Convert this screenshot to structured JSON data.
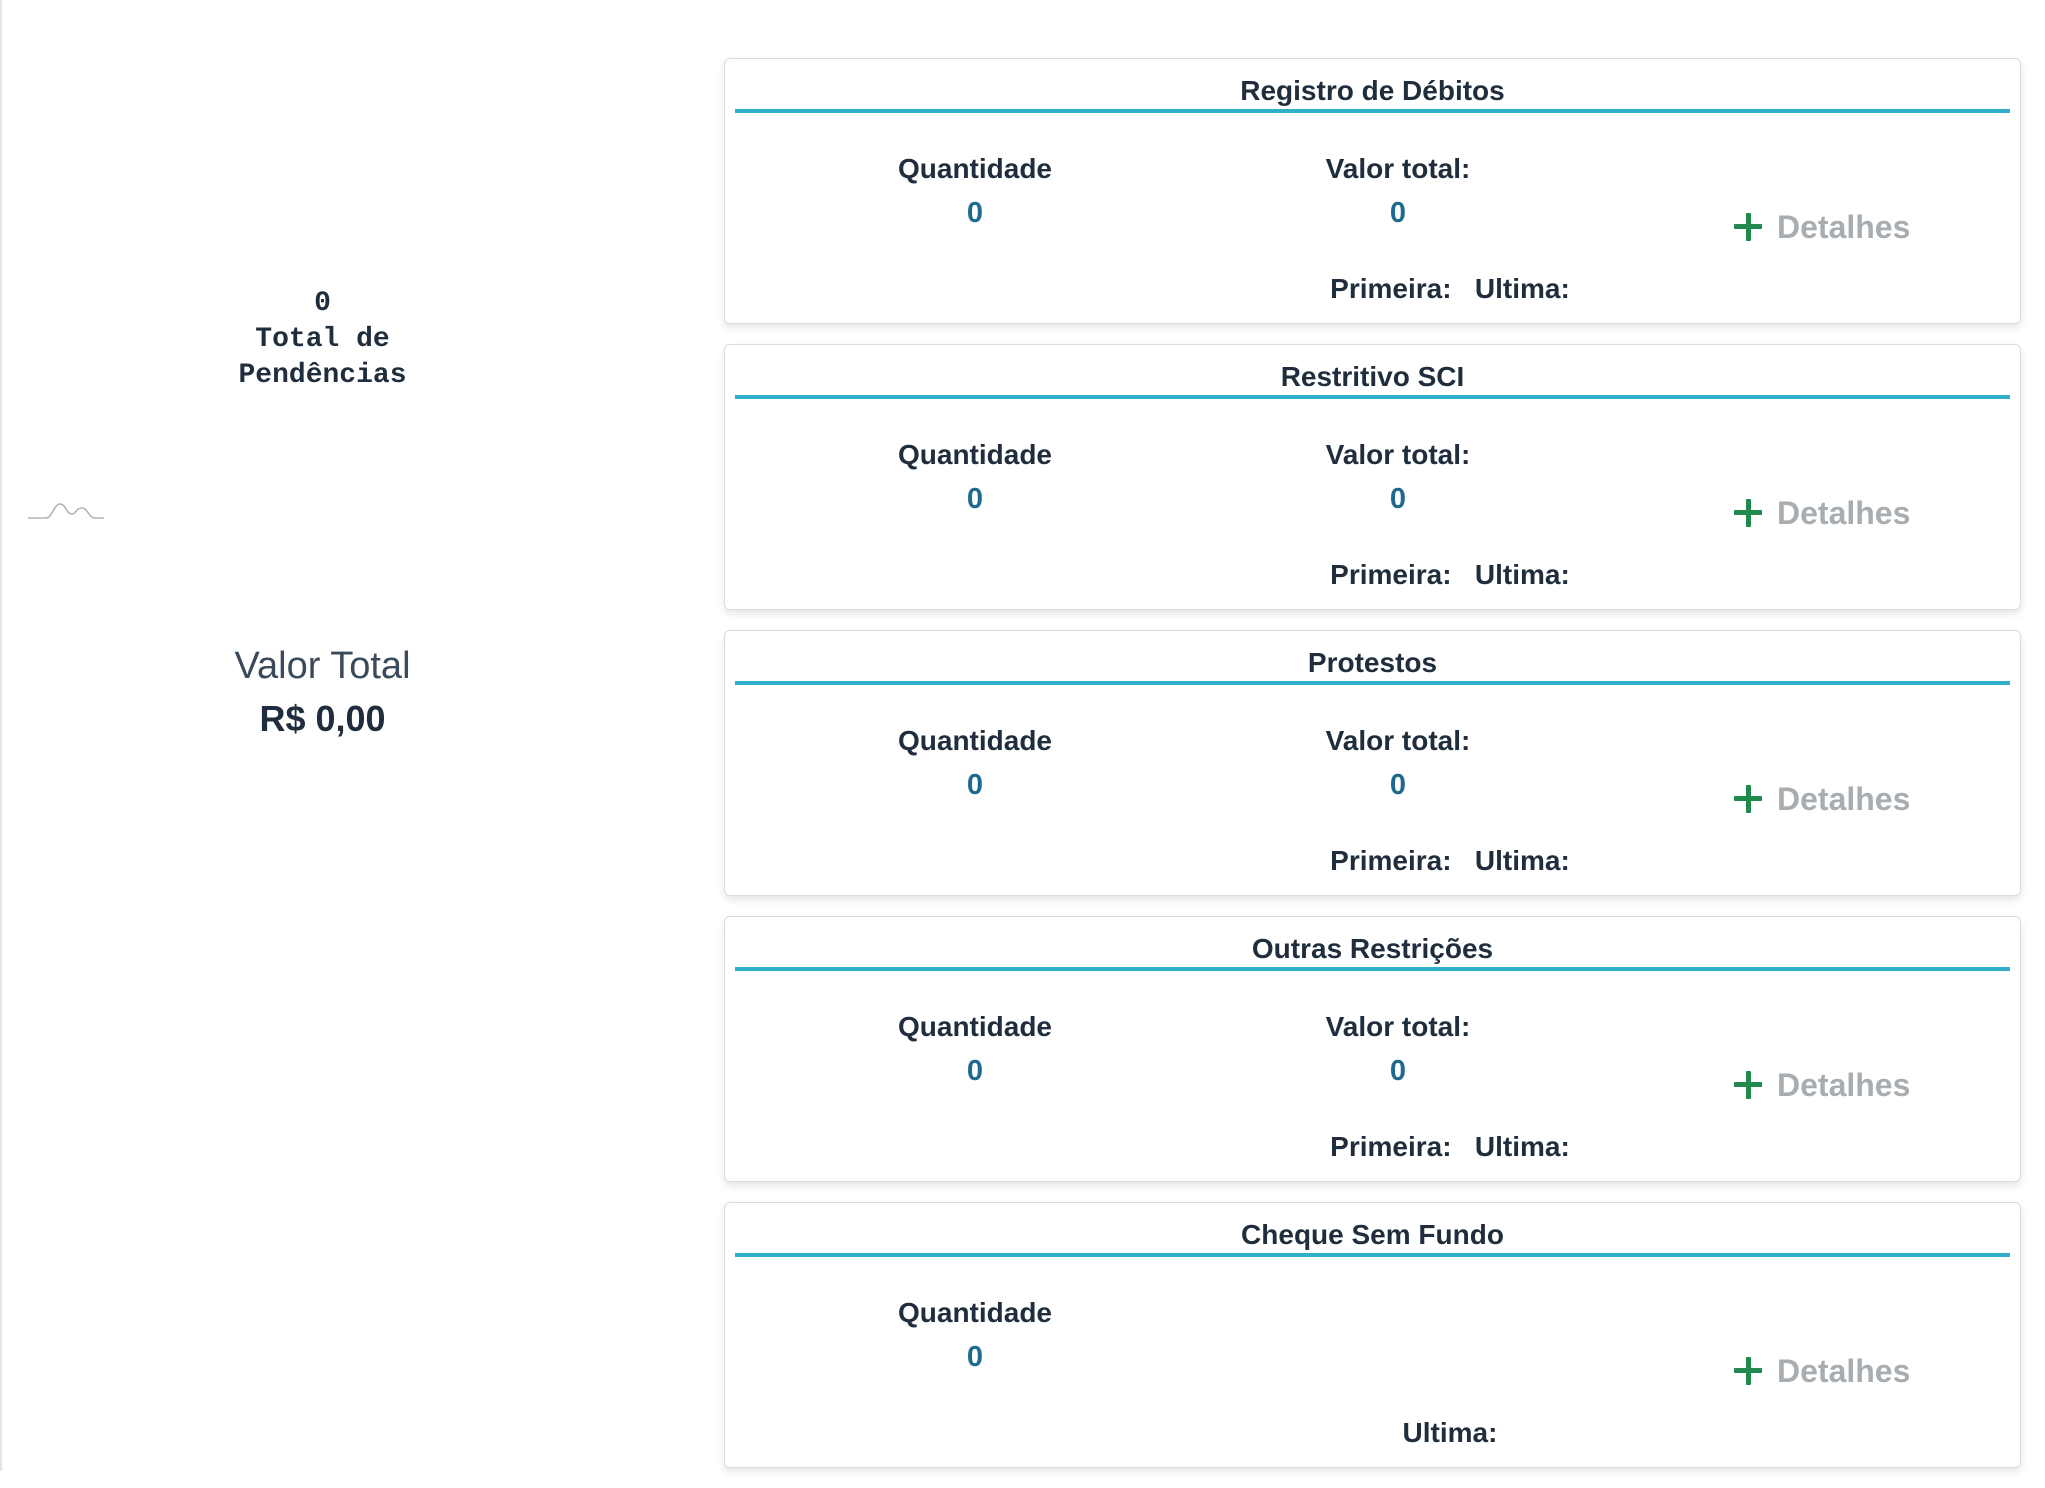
{
  "summary": {
    "pendencias_count": "0",
    "pendencias_label_line1": "Total de",
    "pendencias_label_line2": "Pendências",
    "valor_total_label": "Valor Total",
    "valor_total_value": "R$ 0,00"
  },
  "cards": [
    {
      "title": "Registro de Débitos",
      "quantidade_label": "Quantidade",
      "quantidade_value": "0",
      "valor_label": "Valor total:",
      "valor_value": "0",
      "dates": "Primeira:   Ultima:",
      "details_label": "Detalhes"
    },
    {
      "title": "Restritivo SCI",
      "quantidade_label": "Quantidade",
      "quantidade_value": "0",
      "valor_label": "Valor total:",
      "valor_value": "0",
      "dates": "Primeira:   Ultima:",
      "details_label": "Detalhes"
    },
    {
      "title": "Protestos",
      "quantidade_label": "Quantidade",
      "quantidade_value": "0",
      "valor_label": "Valor total:",
      "valor_value": "0",
      "dates": "Primeira:   Ultima:",
      "details_label": "Detalhes"
    },
    {
      "title": "Outras Restrições",
      "quantidade_label": "Quantidade",
      "quantidade_value": "0",
      "valor_label": "Valor total:",
      "valor_value": "0",
      "dates": "Primeira:   Ultima:",
      "details_label": "Detalhes"
    },
    {
      "title": "Cheque Sem Fundo",
      "quantidade_label": "Quantidade",
      "quantidade_value": "0",
      "dates": "Ultima:",
      "details_label": "Detalhes"
    }
  ],
  "colors": {
    "accent_line": "#2fb0c8",
    "value_text": "#1d6a8e",
    "plus_icon": "#1f8a4c",
    "details_text": "#a8adb2"
  }
}
